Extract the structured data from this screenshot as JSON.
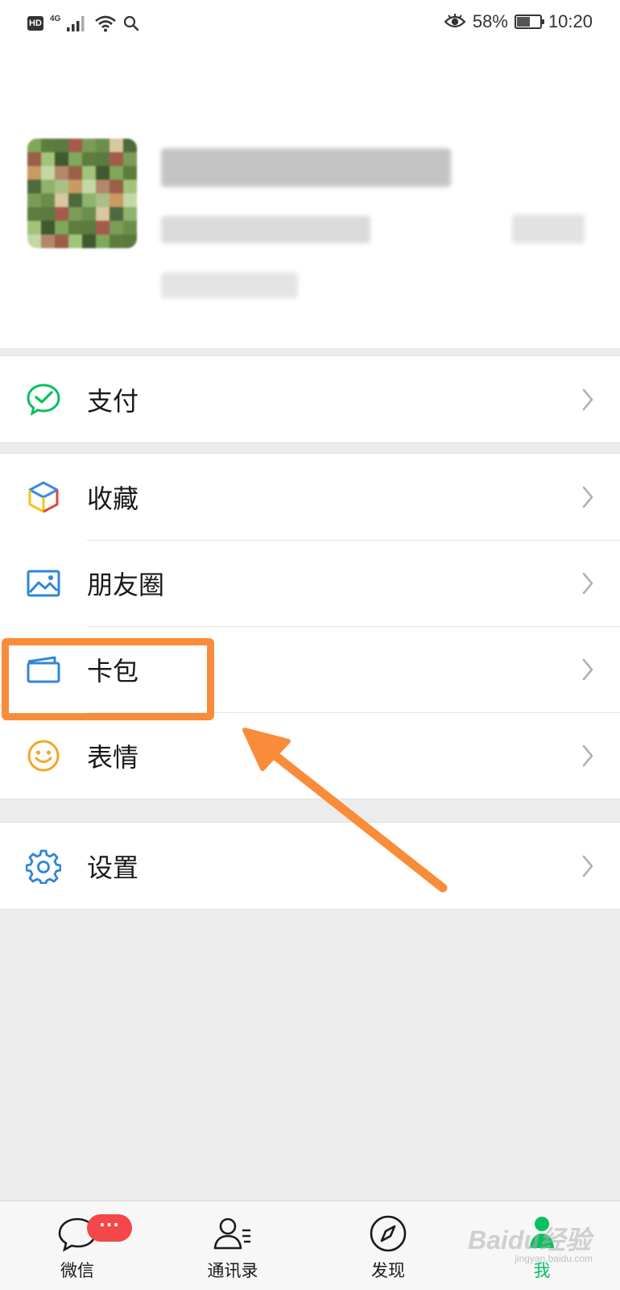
{
  "status_bar": {
    "hd": "HD",
    "network": "4G",
    "battery_percent": "58%",
    "battery_level": 0.58,
    "time": "10:20"
  },
  "menu": {
    "pay": "支付",
    "favorites": "收藏",
    "moments": "朋友圈",
    "card_wallet": "卡包",
    "stickers": "表情",
    "settings": "设置"
  },
  "tabbar": {
    "chats": "微信",
    "chats_badge": "···",
    "contacts": "通讯录",
    "discover": "发现",
    "me": "我",
    "active_tab": "me"
  },
  "watermark": {
    "text": "Baidu经验",
    "sub": "jingyan.baidu.com"
  },
  "colors": {
    "accent": "#07c160",
    "annotation": "#f98c3a",
    "badge": "#f3474a",
    "background": "#ececec"
  }
}
